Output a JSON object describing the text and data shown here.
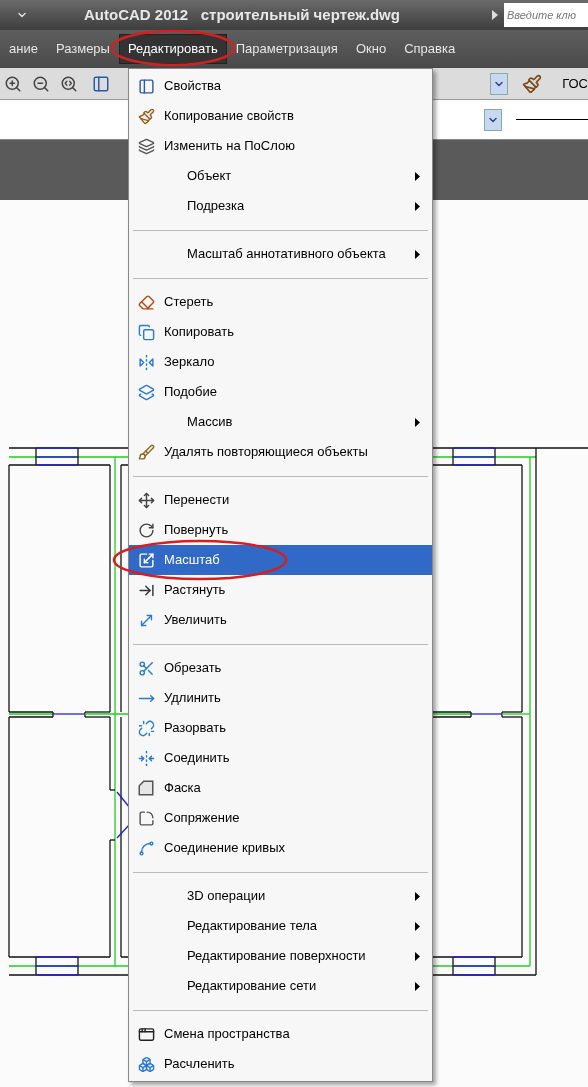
{
  "window": {
    "title": "AutoCAD 2012   строительный чертеж.dwg",
    "search": {
      "placeholder": "Введите клю"
    }
  },
  "menu_bar": [
    {
      "label": "ание",
      "selected": false
    },
    {
      "label": "Размеры",
      "selected": false
    },
    {
      "label": "Редактировать",
      "selected": true
    },
    {
      "label": "Параметризация",
      "selected": false
    },
    {
      "label": "Окно",
      "selected": false
    },
    {
      "label": "Справка",
      "selected": false
    }
  ],
  "toolbar": {
    "style_value": "ГОС"
  },
  "edit_menu": {
    "items": [
      {
        "kind": "command",
        "label": "Свойства",
        "selected": false
      },
      {
        "kind": "command",
        "label": "Копирование свойств",
        "selected": false
      },
      {
        "kind": "command",
        "label": "Изменить на ПоСлою",
        "selected": false
      },
      {
        "kind": "submenu",
        "label": "Объект",
        "selected": false
      },
      {
        "kind": "submenu",
        "label": "Подрезка",
        "selected": false
      },
      {
        "kind": "separator"
      },
      {
        "kind": "submenu",
        "label": "Масштаб аннотативного объекта",
        "selected": false
      },
      {
        "kind": "separator"
      },
      {
        "kind": "command",
        "label": "Стереть",
        "selected": false
      },
      {
        "kind": "command",
        "label": "Копировать",
        "selected": false
      },
      {
        "kind": "command",
        "label": "Зеркало",
        "selected": false
      },
      {
        "kind": "command",
        "label": "Подобие",
        "selected": false
      },
      {
        "kind": "submenu",
        "label": "Массив",
        "selected": false
      },
      {
        "kind": "command",
        "label": "Удалять повторяющиеся объекты",
        "selected": false
      },
      {
        "kind": "separator"
      },
      {
        "kind": "command",
        "label": "Перенести",
        "selected": false
      },
      {
        "kind": "command",
        "label": "Повернуть",
        "selected": false
      },
      {
        "kind": "command",
        "label": "Масштаб",
        "selected": true
      },
      {
        "kind": "command",
        "label": "Растянуть",
        "selected": false
      },
      {
        "kind": "command",
        "label": "Увеличить",
        "selected": false
      },
      {
        "kind": "separator"
      },
      {
        "kind": "command",
        "label": "Обрезать",
        "selected": false
      },
      {
        "kind": "command",
        "label": "Удлинить",
        "selected": false
      },
      {
        "kind": "command",
        "label": "Разорвать",
        "selected": false
      },
      {
        "kind": "command",
        "label": "Соединить",
        "selected": false
      },
      {
        "kind": "command",
        "label": "Фаска",
        "selected": false
      },
      {
        "kind": "command",
        "label": "Сопряжение",
        "selected": false
      },
      {
        "kind": "command",
        "label": "Соединение кривых",
        "selected": false
      },
      {
        "kind": "separator"
      },
      {
        "kind": "submenu",
        "label": "3D операции",
        "selected": false
      },
      {
        "kind": "submenu",
        "label": "Редактирование тела",
        "selected": false
      },
      {
        "kind": "submenu",
        "label": "Редактирование поверхности",
        "selected": false
      },
      {
        "kind": "submenu",
        "label": "Редактирование сети",
        "selected": false
      },
      {
        "kind": "separator"
      },
      {
        "kind": "command",
        "label": "Смена пространства",
        "selected": false
      },
      {
        "kind": "command",
        "label": "Расчленить",
        "selected": false
      }
    ]
  }
}
